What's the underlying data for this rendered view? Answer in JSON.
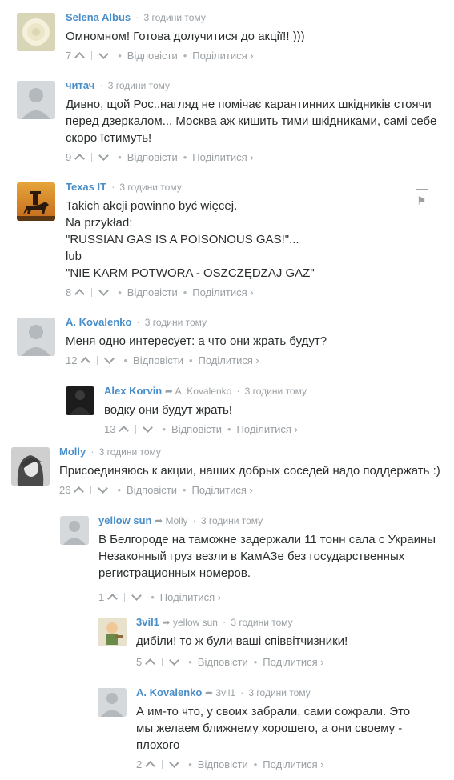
{
  "common": {
    "reply": "Відповісти",
    "share": "Поділитися ›"
  },
  "comments": [
    {
      "author": "Selena Albus",
      "reply_to": "",
      "time": "3 години тому",
      "lines": [
        "Омномном! Готова долучитися до акції!! )))"
      ],
      "votes": "7",
      "has_reply": true
    },
    {
      "author": "читач",
      "reply_to": "",
      "time": "3 години тому",
      "lines": [
        "Дивно, щой Рос..нагляд не помічає карантинних шкідників стоячи",
        "перед дзеркалом... Москва аж кишить тими шкідниками, самі себе",
        "скоро їстимуть!"
      ],
      "votes": "9",
      "has_reply": true
    },
    {
      "author": "Texas IT",
      "reply_to": "",
      "time": "3 години тому",
      "lines": [
        "Takich akcji powinno być więcej.",
        "Na przykład:",
        "\"RUSSIAN GAS IS A POISONOUS GAS!\"...",
        "lub",
        "\"NIE KARM POTWORA - OSZCZĘDZAJ GAZ\""
      ],
      "votes": "8",
      "has_reply": true
    },
    {
      "author": "A. Kovalenko",
      "reply_to": "",
      "time": "3 години тому",
      "lines": [
        "Меня одно интересует: а что они жрать будут?"
      ],
      "votes": "12",
      "has_reply": true
    },
    {
      "author": "Alex Korvin",
      "reply_to": "A. Kovalenko",
      "time": "3 години тому",
      "lines": [
        "водку они будут жрать!"
      ],
      "votes": "13",
      "has_reply": true
    },
    {
      "author": "Molly",
      "reply_to": "",
      "time": "3 години тому",
      "lines": [
        "Присоединяюсь к акции, наших добрых соседей надо поддержать :)"
      ],
      "votes": "26",
      "has_reply": true
    },
    {
      "author": "yellow sun",
      "reply_to": "Molly",
      "time": "3 години тому",
      "lines": [
        "В Белгороде на таможне задержали 11 тонн сала с Украины",
        "Незаконный груз везли в КамАЗе без государственных",
        "регистрационных номеров."
      ],
      "votes": "1",
      "has_reply": false
    },
    {
      "author": "3vil1",
      "reply_to": "yellow sun",
      "time": "3 години тому",
      "lines": [
        "дибіли! то ж були ваші співвітчизники!"
      ],
      "votes": "5",
      "has_reply": true
    },
    {
      "author": "A. Kovalenko",
      "reply_to": "3vil1",
      "time": "3 години тому",
      "lines": [
        "А им-то что, у своих забрали, сами сожрали. Это",
        "мы желаем ближнему хорошего, а они своему -",
        "плохого"
      ],
      "votes": "2",
      "has_reply": true
    }
  ],
  "controls": {
    "collapse": "—",
    "flag": "⚑"
  }
}
